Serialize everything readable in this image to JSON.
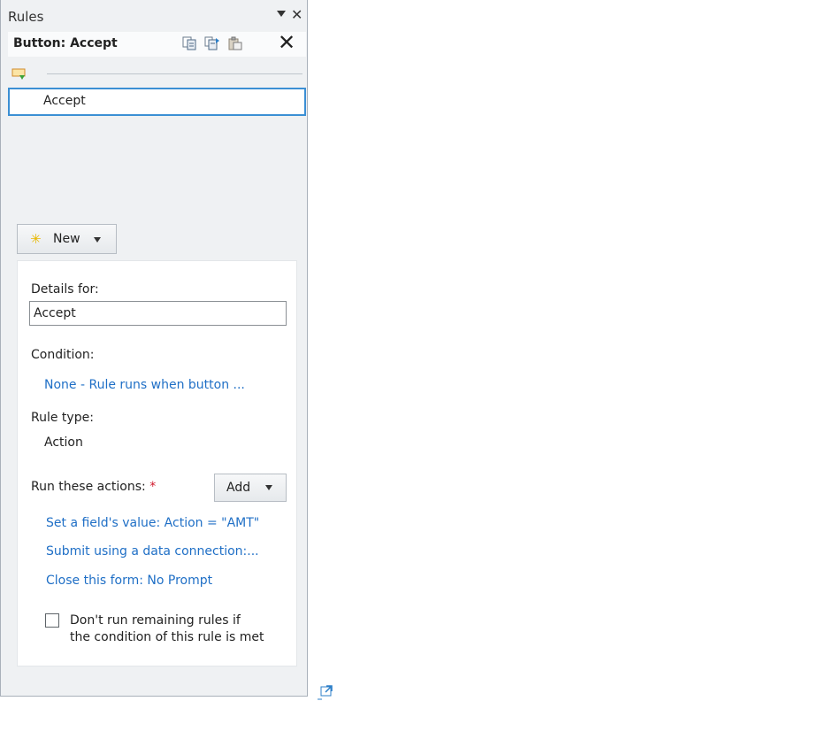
{
  "pane": {
    "title": "Rules",
    "close_glyph": "✕",
    "header": "Button: Accept",
    "header_icons": [
      "copy-rule-icon",
      "copy-all-rules-icon",
      "paste-rule-icon"
    ],
    "header_close_glyph": "✕"
  },
  "rules": [
    {
      "label": "Accept",
      "selected": true
    }
  ],
  "new_button": {
    "label": "New"
  },
  "details": {
    "details_label": "Details for:",
    "rule_name": "Accept",
    "condition_label": "Condition:",
    "condition_link": "None - Rule runs when button ...",
    "rule_type_label": "Rule type:",
    "rule_type_value": "Action",
    "actions_label": "Run these actions:",
    "required_mark": "*",
    "add_button": "Add",
    "actions": [
      "Set a field's value: Action = \"AMT\"",
      "Submit using a data connection:...",
      "Close this form: No Prompt"
    ],
    "stop_line1": "Don't run remaining rules if",
    "stop_line2": "the condition of this rule is met",
    "stop_checked": false
  },
  "colors": {
    "accent": "#3b8fd4",
    "link": "#1f6fc6",
    "required": "#d0182b",
    "pane_bg": "#eff1f3"
  },
  "icons": {
    "new": "sparkle-icon",
    "rule": "rule-action-icon",
    "popout": "popout-icon"
  }
}
